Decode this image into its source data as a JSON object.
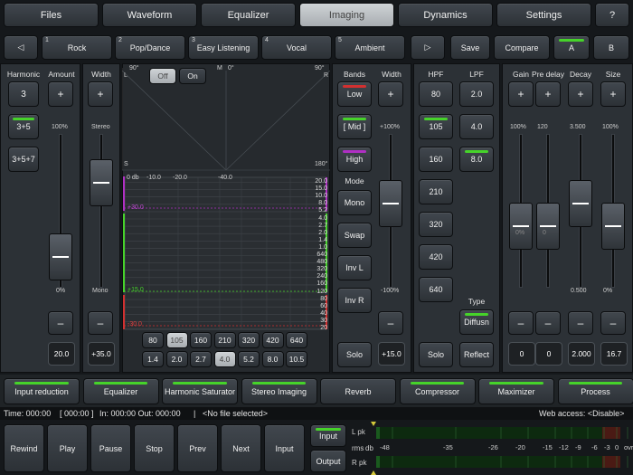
{
  "tabs": [
    "Files",
    "Waveform",
    "Equalizer",
    "Imaging",
    "Dynamics",
    "Settings",
    "?"
  ],
  "active_tab": "Imaging",
  "presets": {
    "prev": "◁",
    "next": "▷",
    "items": [
      {
        "n": "1",
        "label": "Rock"
      },
      {
        "n": "2",
        "label": "Pop/Dance"
      },
      {
        "n": "3",
        "label": "Easy Listening"
      },
      {
        "n": "4",
        "label": "Vocal"
      },
      {
        "n": "5",
        "label": "Ambient"
      }
    ],
    "save": "Save",
    "compare": "Compare",
    "a": "A",
    "b": "B"
  },
  "harmonic": {
    "label": "Harmonic",
    "b1": "3",
    "b2": "3+5",
    "b3": "3+5+7"
  },
  "amount": {
    "label": "Amount",
    "plus": "+",
    "minus": "–",
    "top": "100%",
    "bottom": "0%",
    "value": "20.0",
    "level": 0.2
  },
  "width_left": {
    "label": "Width",
    "plus": "+",
    "minus": "–",
    "top": "Stereo",
    "bottom": "Mono",
    "value": "+35.0",
    "level": 0.68
  },
  "display": {
    "off": "Off",
    "on": "On",
    "l": "L",
    "m": "M",
    "r": "R",
    "deg_l": "90°",
    "deg_m": "0°",
    "deg_r": "90°",
    "s": "S",
    "deg_bottom": "180°",
    "db": "0 db",
    "tick1": "-10.0",
    "tick2": "-20.0",
    "tick3": "-40.0",
    "purple_mark": "+30.0",
    "green_mark": "+15.0",
    "red_mark": "-30.0"
  },
  "scale_right": [
    "20.0",
    "15.0",
    "10.0",
    "8.0",
    "5.2",
    "4.0",
    "2.7",
    "2.0",
    "1.4",
    "1.0",
    "640",
    "480",
    "320",
    "240",
    "160",
    "120",
    "80",
    "60",
    "40",
    "30",
    "20"
  ],
  "freq_row1": [
    "80",
    "105",
    "160",
    "210",
    "320",
    "420",
    "640"
  ],
  "freq_row2": [
    "1.4",
    "2.0",
    "2.7",
    "4.0",
    "5.2",
    "8.0",
    "10.5"
  ],
  "bands": {
    "label": "Bands",
    "low": "Low",
    "mid": "[ Mid ]",
    "high": "High",
    "mode": "Mode",
    "mono": "Mono",
    "swap": "Swap",
    "invl": "Inv L",
    "invr": "Inv R",
    "solo": "Solo"
  },
  "width_band": {
    "label": "Width",
    "plus": "+",
    "minus": "–",
    "top": "+100%",
    "bottom": "-100%",
    "value": "+15.0",
    "level": 0.55
  },
  "hpf": {
    "label": "HPF",
    "items": [
      "80",
      "105",
      "160",
      "210",
      "320",
      "420",
      "640"
    ],
    "solo": "Solo"
  },
  "lpf": {
    "label": "LPF",
    "items": [
      "2.0",
      "4.0",
      "8.0"
    ],
    "type": "Type",
    "diffusn": "Diffusn",
    "reflect": "Reflect"
  },
  "gain": {
    "label": "Gain",
    "plus": "+",
    "minus": "–",
    "top": "100%",
    "inner": "0%",
    "value": "0",
    "level": 0.4
  },
  "predelay": {
    "label": "Pre delay",
    "plus": "+",
    "minus": "–",
    "top": "120",
    "inner": "0",
    "value": "0",
    "level": 0.4
  },
  "decay": {
    "label": "Decay",
    "plus": "+",
    "minus": "–",
    "top": "3.500",
    "bottom": "0.500",
    "value": "2.000",
    "level": 0.55
  },
  "size": {
    "label": "Size",
    "plus": "+",
    "minus": "–",
    "top": "100%",
    "bottom": "0%",
    "value": "16.7",
    "level": 0.4
  },
  "modules": [
    "Input reduction",
    "Equalizer",
    "Harmonic Saturator",
    "Stereo Imaging",
    "Reverb",
    "Compressor",
    "Maximizer",
    "Process"
  ],
  "status": {
    "time": "Time: 000:00",
    "bracket": "[  000:00  ]",
    "inout": "In: 000:00 Out: 000:00",
    "sep": "|",
    "file": "<No file selected>",
    "web": "Web access: <Disable>"
  },
  "transport": [
    "Rewind",
    "Play",
    "Pause",
    "Stop",
    "Prev",
    "Next",
    "Input"
  ],
  "io": {
    "input": "Input",
    "output": "Output"
  },
  "meter": {
    "lpk": "L pk",
    "rms": "rms",
    "db": "db",
    "rpk": "R pk",
    "ticks": [
      "-48",
      "-35",
      "-26",
      "-20",
      "-15",
      "-12",
      "-9",
      "-6",
      "-3",
      "0",
      "ovr"
    ]
  },
  "colors": {
    "accent_green": "#46d32a",
    "purple": "#b02fc4",
    "red": "#d23030"
  }
}
